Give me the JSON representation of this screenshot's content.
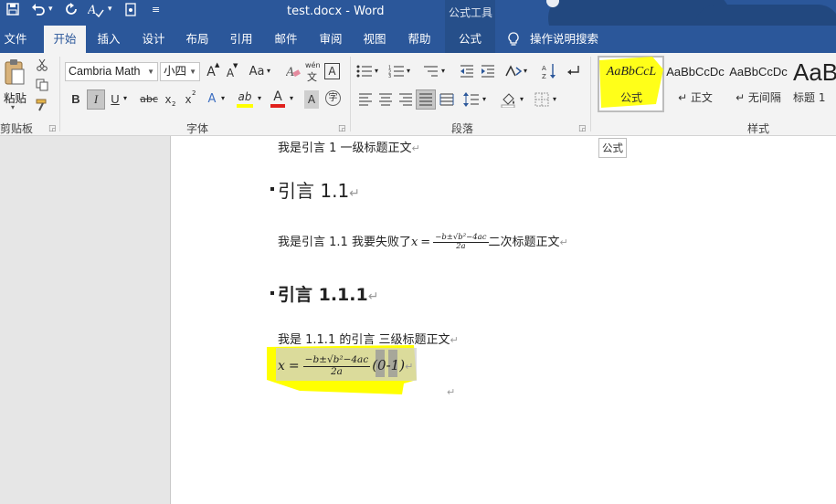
{
  "window": {
    "doc_title": "test.docx - Word",
    "context_tool": "公式工具"
  },
  "qat": {
    "save_icon": "save-icon",
    "undo_icon": "undo-icon",
    "redo_icon": "redo-icon",
    "format_icon": "format-painter-icon",
    "touch_icon": "touch-mode-icon",
    "more": "▾"
  },
  "tabs": [
    {
      "label": "文件"
    },
    {
      "label": "开始"
    },
    {
      "label": "插入"
    },
    {
      "label": "设计"
    },
    {
      "label": "布局"
    },
    {
      "label": "引用"
    },
    {
      "label": "邮件"
    },
    {
      "label": "审阅"
    },
    {
      "label": "视图"
    },
    {
      "label": "帮助"
    },
    {
      "label": "公式"
    }
  ],
  "tell_me": "操作说明搜索",
  "ribbon": {
    "clipboard": {
      "paste_label": "粘贴",
      "group_label": "剪贴板"
    },
    "font": {
      "font_name": "Cambria Math",
      "font_size": "小四",
      "grow": "A",
      "shrink": "A",
      "change_case": "Aa",
      "phonetic_top": "wén",
      "phonetic_bottom": "文",
      "char_border": "A",
      "bold": "B",
      "italic": "I",
      "underline": "U",
      "strike": "abc",
      "subscript": "x",
      "superscript": "x",
      "sub_mark": "2",
      "sup_mark": "2",
      "effects": "A",
      "highlight": "ab",
      "font_color": "A",
      "char_shading": "A",
      "enclose": "字",
      "group_label": "字体"
    },
    "paragraph": {
      "group_label": "段落"
    },
    "styles": {
      "group_label": "样式",
      "items": [
        {
          "sample": "AaBbCcL",
          "name": "公式"
        },
        {
          "sample": "AaBbCcDc",
          "name": "↵ 正文"
        },
        {
          "sample": "AaBbCcDc",
          "name": "↵ 无间隔"
        },
        {
          "sample": "AaB",
          "name": "标题 1"
        }
      ]
    }
  },
  "tooltip": "公式",
  "document": {
    "p1": "我是引言 1  一级标题正文",
    "h2": "引言 1.1",
    "p2_before": "我是引言 1.1  我要失败了",
    "p2_after": "二次标题正文",
    "h3": "引言 1.1.1",
    "p3": "我是 1.1.1 的引言  三级标题正文",
    "eq_var": "x",
    "eq_eq": "=",
    "eq_num": "−b±√b²−4ac",
    "eq_den": "2a",
    "eq_label": "(0-1)",
    "para_mark": "↵"
  },
  "colors": {
    "accent": "#2b579a",
    "highlight": "#ffff00"
  }
}
